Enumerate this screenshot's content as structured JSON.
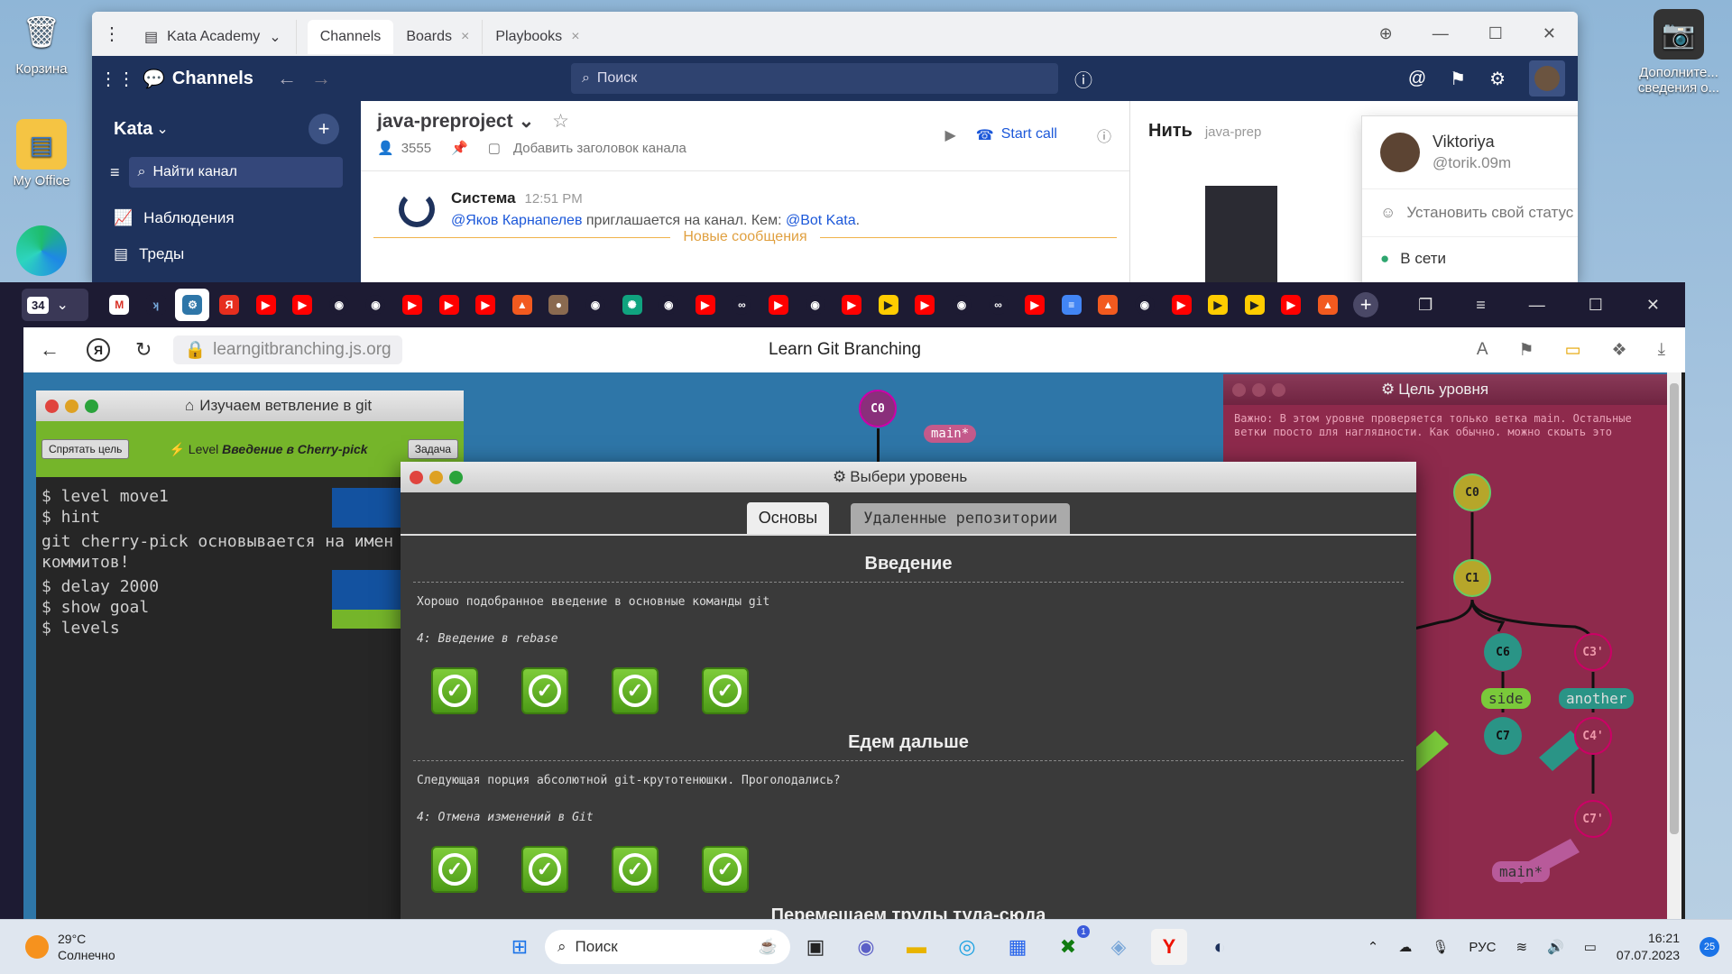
{
  "desktop": {
    "icons": [
      {
        "label": "Корзина"
      },
      {
        "label": "My Office"
      },
      {
        "label": ""
      }
    ],
    "right_icon_label": "Дополните... сведения о..."
  },
  "mattermost": {
    "team_tab": "Kata Academy",
    "tabs": [
      "Channels",
      "Boards",
      "Playbooks"
    ],
    "product": "Channels",
    "search_placeholder": "Поиск",
    "team_name": "Kata",
    "find_channel": "Найти канал",
    "sidebar_items": [
      "Наблюдения",
      "Треды"
    ],
    "channel": {
      "name": "java-preproject",
      "members": "3555",
      "add_header": "Добавить заголовок канала",
      "start_call": "Start call"
    },
    "message": {
      "author": "Система",
      "time": "12:51 PM",
      "mention1": "@Яков Карнапелев",
      "text": " приглашается на канал. Кем: ",
      "mention2": "@Bot Kata",
      "tail": "."
    },
    "new_messages": "Новые сообщения",
    "thread": {
      "title": "Нить",
      "channel": "java-prep"
    },
    "user_menu": {
      "name": "Viktoriya",
      "handle": "@torik.09m",
      "set_status": "Установить свой статус",
      "online": "В сети"
    }
  },
  "browser": {
    "tab_count": "34",
    "url": "learngitbranching.js.org",
    "page_title": "Learn Git Branching",
    "tab_icons": [
      "gmail",
      "kata",
      "lgb",
      "yandex",
      "yt",
      "yt",
      "gh",
      "gh",
      "yt",
      "yt",
      "yt",
      "brave",
      "img",
      "gh",
      "chatgpt",
      "gh",
      "yt",
      "link",
      "yt",
      "gh",
      "yt",
      "play",
      "yt",
      "gh",
      "link",
      "yt",
      "doc",
      "brave",
      "gh",
      "yt",
      "play",
      "play",
      "yt",
      "brave"
    ]
  },
  "lgb": {
    "left_title": "Изучаем ветвление в git",
    "hide_goal": "Спрятать цель",
    "level_prefix": "Level",
    "level_name": "Введение в Cherry-pick",
    "task": "Задача",
    "terminal": [
      "$ level move1",
      "$ hint",
      "git cherry-pick основывается на имен",
      "коммитов!",
      "$ delay 2000",
      "$ show goal",
      "$ levels"
    ],
    "goal_title": "Цель уровня",
    "goal_text": "Важно: В этом уровне проверяется только ветка main. Остальные ветки просто для наглядности. Как обычно, можно скрыть это сообщение при",
    "main_label": "main*",
    "goal_nodes": [
      "C0",
      "C1",
      "C6",
      "C3'",
      "C7",
      "C4'",
      "C7'"
    ],
    "goal_branches": [
      "side",
      "another",
      "main*"
    ],
    "bg_node": "C0",
    "dialog": {
      "title": "Выбери уровень",
      "tabs": [
        "Основы",
        "Удаленные репозитории"
      ],
      "sections": [
        {
          "title": "Введение",
          "desc": "Хорошо подобранное введение в основные команды git",
          "sub": "4: Введение в rebase",
          "done": 4
        },
        {
          "title": "Едем дальше",
          "desc": "Следующая порция абсолютной git-крутотенюшки. Проголодались?",
          "sub": "4: Отмена изменений в Git",
          "done": 4
        }
      ],
      "next_section": "Перемещаем труды туда-сюда"
    }
  },
  "taskbar": {
    "weather_temp": "29°C",
    "weather_desc": "Солнечно",
    "search": "Поиск",
    "lang": "РУС",
    "time": "16:21",
    "date": "07.07.2023",
    "notif": "25",
    "teams_badge": "1"
  },
  "colors": {
    "mm_nav": "#1e325c",
    "lgb_bg": "#2e76a8",
    "goal_bg": "#8e2a4c",
    "check": "#5cb020"
  }
}
